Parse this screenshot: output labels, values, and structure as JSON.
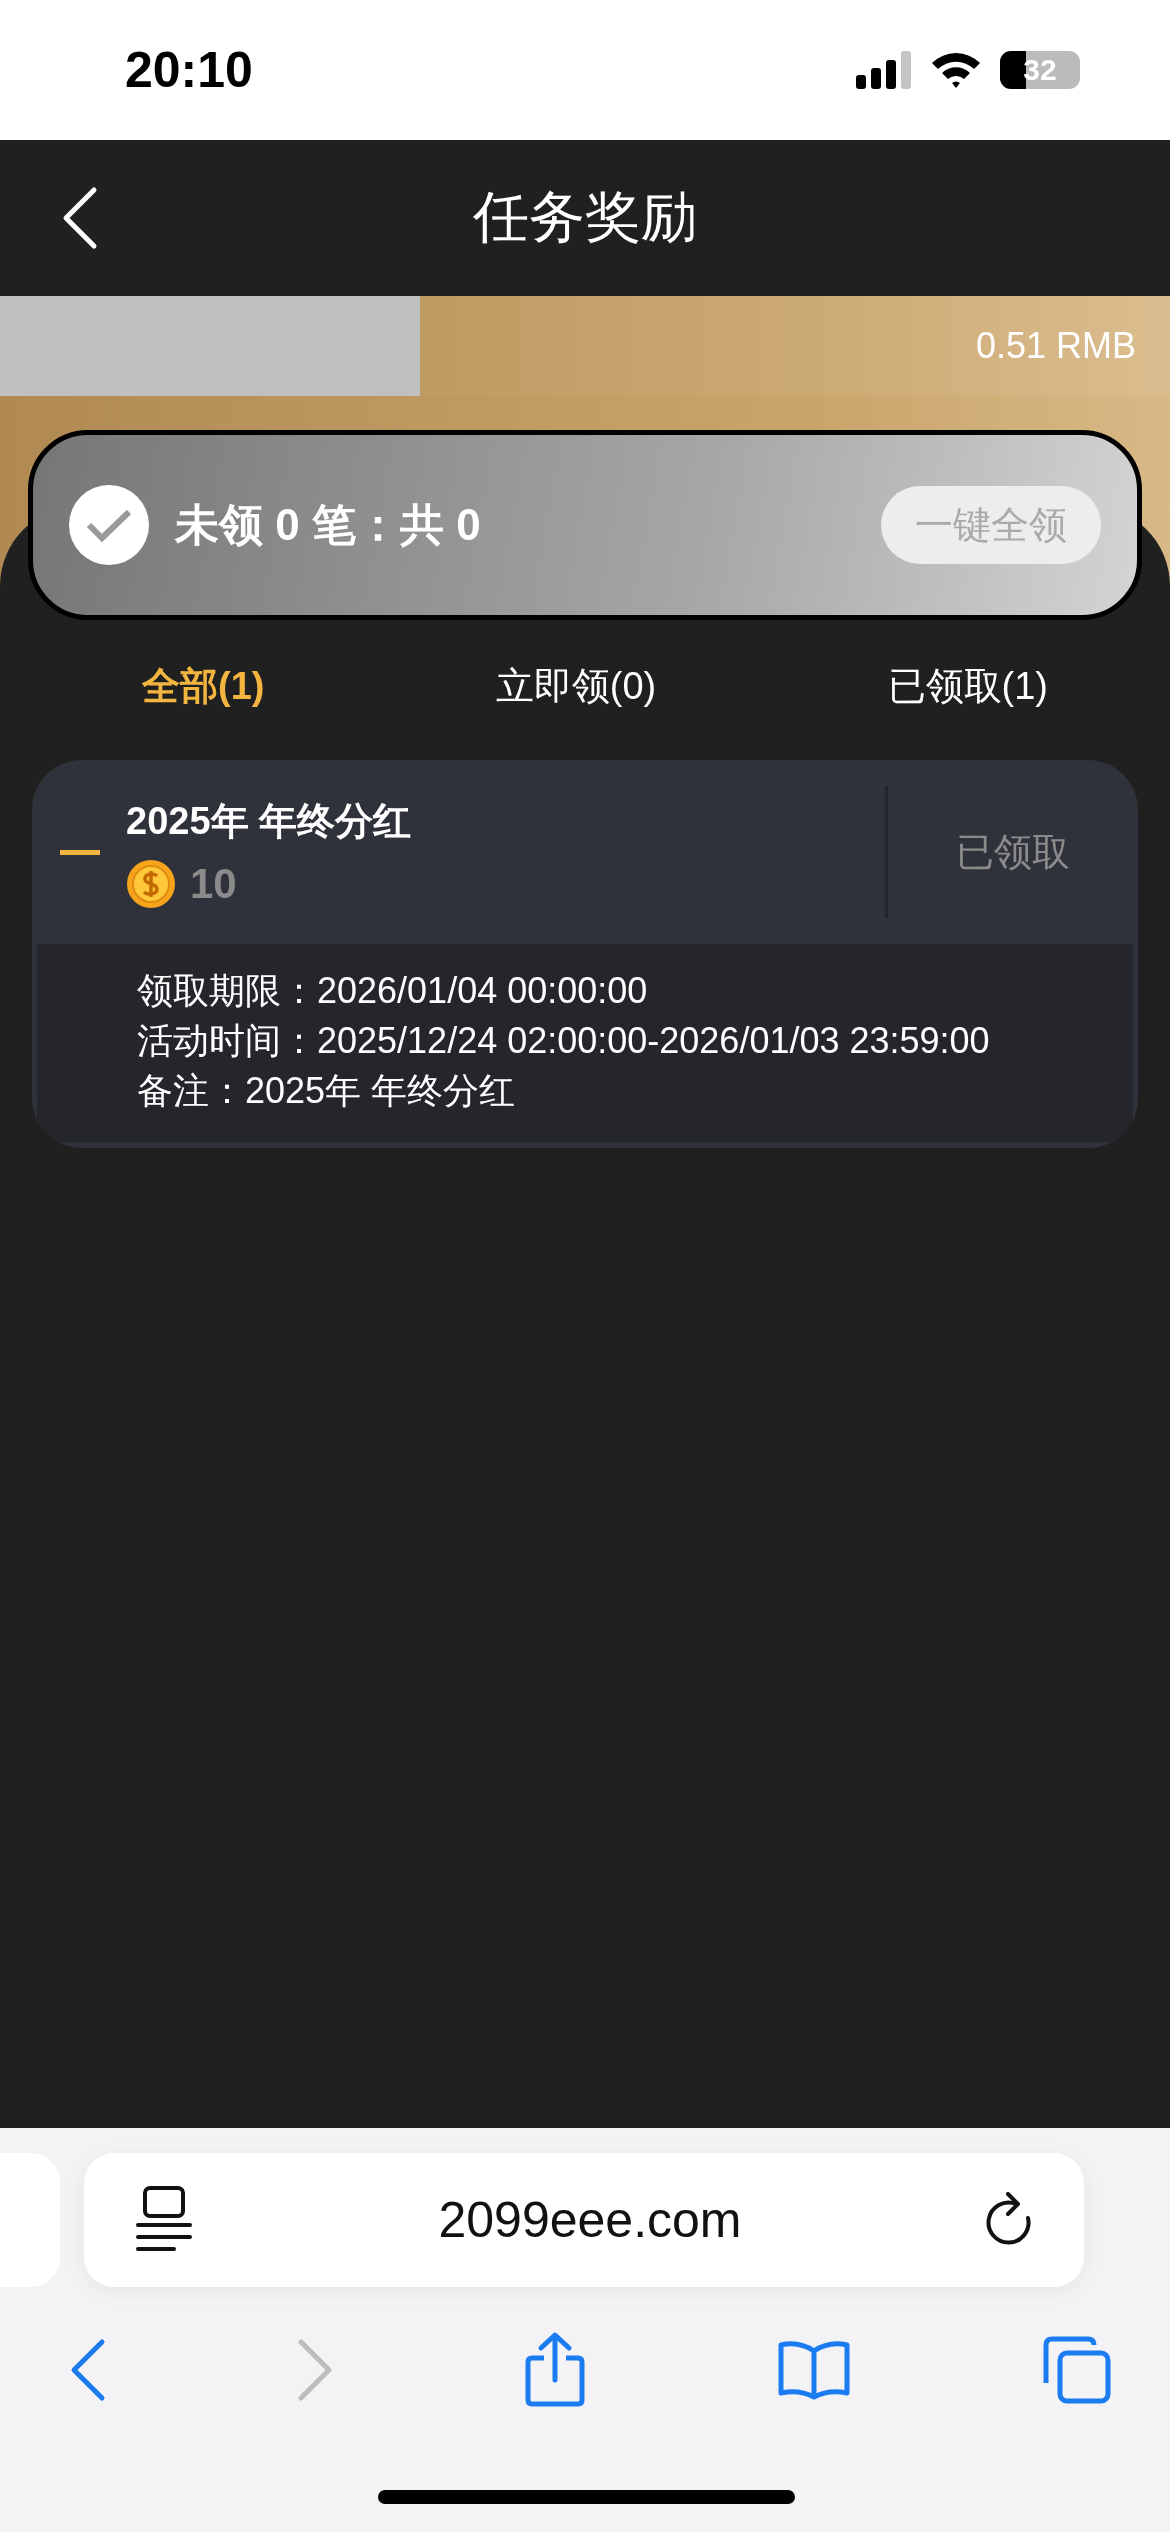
{
  "status_bar": {
    "time": "20:10",
    "battery": "32"
  },
  "nav": {
    "title": "任务奖励"
  },
  "banner": {
    "amount": "0.51 RMB"
  },
  "summary": {
    "checked": true,
    "text": "未领 0 笔：共 0",
    "button": "一键全领",
    "button_disabled": true
  },
  "tabs": [
    {
      "label": "全部(1)",
      "selected": true
    },
    {
      "label": "立即领(0)",
      "selected": false
    },
    {
      "label": "已领取(1)",
      "selected": false
    }
  ],
  "tasks": [
    {
      "title": "2025年 年终分红",
      "amount": "10",
      "status": "已领取",
      "expanded": true,
      "details": [
        "领取期限：2026/01/04 00:00:00",
        "活动时间：2025/12/24 02:00:00-2026/01/03 23:59:00",
        "备注：2025年 年终分红"
      ]
    }
  ],
  "browser": {
    "url": "2099eee.com",
    "back_disabled": false,
    "forward_disabled": true
  }
}
